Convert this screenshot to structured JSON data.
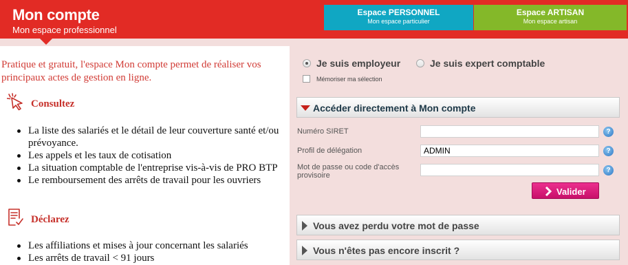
{
  "header": {
    "title": "Mon compte",
    "subtitle": "Mon espace professionnel",
    "tabs": [
      {
        "title": "Espace PERSONNEL",
        "subtitle": "Mon espace particulier",
        "color": "#10a7c3"
      },
      {
        "title": "Espace ARTISAN",
        "subtitle": "Mon espace artisan",
        "color": "#84b829"
      }
    ],
    "accent_color": "#e22b25"
  },
  "intro": "Pratique et gratuit, l'espace Mon compte permet de réaliser vos principaux actes de gestion en ligne.",
  "sections": [
    {
      "title": "Consultez",
      "icon": "cursor-click-icon",
      "items": [
        "La liste des salariés et le détail de leur couverture santé et/ou prévoyance.",
        "Les appels et les taux de cotisation",
        "La situation comptable de l'entreprise vis-à-vis de PRO BTP",
        "Le remboursement des arrêts de travail pour les ouvriers"
      ]
    },
    {
      "title": "Déclarez",
      "icon": "document-check-icon",
      "items": [
        "Les affiliations et mises à jour concernant les salariés",
        "Les arrêts de travail < 91 jours"
      ]
    }
  ],
  "login": {
    "role_options": [
      {
        "label": "Je suis employeur",
        "checked": true
      },
      {
        "label": "Je suis expert comptable",
        "checked": false
      }
    ],
    "remember_label": "Mémoriser ma sélection",
    "remember_checked": false,
    "direct_access_title": "Accéder directement à Mon compte",
    "fields": [
      {
        "label": "Numéro SIRET",
        "value": ""
      },
      {
        "label": "Profil de délégation",
        "value": "ADMIN"
      },
      {
        "label": "Mot de passe ou code d'accès provisoire",
        "value": ""
      }
    ],
    "help_symbol": "?",
    "submit_label": "Valider",
    "lost_password_title": "Vous avez perdu votre mot de passe",
    "not_registered_title": "Vous n'êtes pas encore inscrit ?"
  }
}
